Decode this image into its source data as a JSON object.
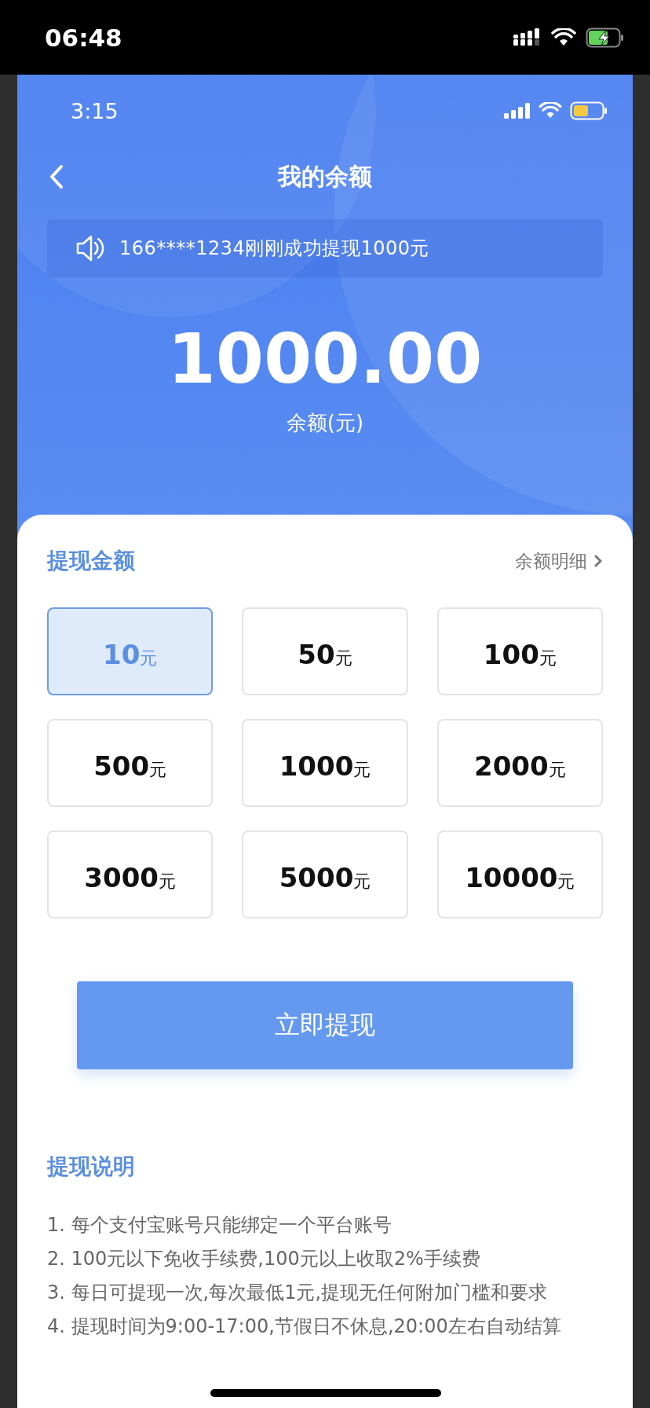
{
  "device_status": {
    "time": "06:48"
  },
  "app_status": {
    "time": "3:15"
  },
  "nav": {
    "title": "我的余额"
  },
  "notice": {
    "text": "166****1234刚刚成功提现1000元"
  },
  "balance": {
    "amount": "1000.00",
    "label": "余额(元)"
  },
  "withdraw": {
    "title": "提现金额",
    "detail_link": "余额明细",
    "options": [
      {
        "amount": "10",
        "unit": "元",
        "selected": true
      },
      {
        "amount": "50",
        "unit": "元",
        "selected": false
      },
      {
        "amount": "100",
        "unit": "元",
        "selected": false
      },
      {
        "amount": "500",
        "unit": "元",
        "selected": false
      },
      {
        "amount": "1000",
        "unit": "元",
        "selected": false
      },
      {
        "amount": "2000",
        "unit": "元",
        "selected": false
      },
      {
        "amount": "3000",
        "unit": "元",
        "selected": false
      },
      {
        "amount": "5000",
        "unit": "元",
        "selected": false
      },
      {
        "amount": "10000",
        "unit": "元",
        "selected": false
      }
    ]
  },
  "submit": {
    "label": "立即提现"
  },
  "instructions": {
    "title": "提现说明",
    "items": [
      "1. 每个支付宝账号只能绑定一个平台账号",
      "2. 100元以下免收手续费,100元以上收取2%手续费",
      "3. 每日可提现一次,每次最低1元,提现无任何附加门槛和要求",
      "4. 提现时间为9:00-17:00,节假日不休息,20:00左右自动结算"
    ]
  }
}
